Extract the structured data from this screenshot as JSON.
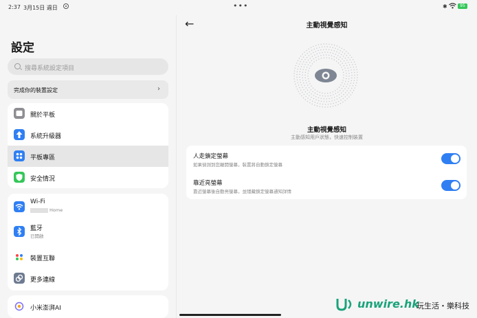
{
  "status_bar": {
    "time": "2:37",
    "date": "3月15日 週日",
    "more": "•••",
    "battery": "95"
  },
  "sidebar": {
    "title": "設定",
    "search_placeholder": "搜尋系統設定項目",
    "promo_label": "完成你的裝置設定",
    "group1": [
      {
        "label": "關於平板",
        "icon": "tablet-icon",
        "color": "#8e8e93"
      },
      {
        "label": "系統升級器",
        "icon": "upgrade-arrow-icon",
        "color": "#2f7ff3"
      },
      {
        "label": "平板專區",
        "icon": "grid-apps-icon",
        "color": "#2f7ff3",
        "selected": true
      },
      {
        "label": "安全情況",
        "icon": "shield-icon",
        "color": "#34c759"
      }
    ],
    "group2": [
      {
        "label": "Wi-Fi",
        "sub": "Home",
        "icon": "wifi-icon",
        "color": "#2f7ff3"
      },
      {
        "label": "藍牙",
        "sub": "已開啟",
        "icon": "bluetooth-icon",
        "color": "#2f7ff3"
      },
      {
        "label": "裝置互聯",
        "icon": "device-link-icon",
        "color": "#ffffff"
      },
      {
        "label": "更多連線",
        "icon": "more-connection-icon",
        "color": "#6e7b91"
      }
    ],
    "group3": [
      {
        "label": "小米澎湃AI",
        "icon": "ai-icon",
        "color": "#ffffff"
      }
    ]
  },
  "detail": {
    "title": "主動視覺感知",
    "feature_title": "主動視覺感知",
    "feature_desc": "主動感知用戶狀態，快速控制裝置",
    "toggles": [
      {
        "label": "人走鎖定螢幕",
        "desc": "如果偵測到您離開螢幕，裝置將自動鎖定螢幕",
        "on": true
      },
      {
        "label": "靠近亮螢幕",
        "desc": "靠近螢幕後自動亮螢幕，並隱藏鎖定螢幕通知詳情",
        "on": true
      }
    ]
  },
  "watermark": {
    "brand": "unwire.hk",
    "tagline": "玩生活・樂科技"
  }
}
